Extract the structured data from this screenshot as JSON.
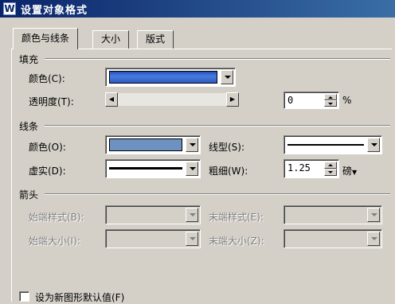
{
  "title": {
    "icon_letter": "W",
    "text": "设置对象格式"
  },
  "tabs": [
    {
      "label": "颜色与线条",
      "active": true
    },
    {
      "label": "大小",
      "active": false
    },
    {
      "label": "版式",
      "active": false
    }
  ],
  "fill": {
    "section": "填充",
    "color_label": "颜色(C):",
    "color_value": "#3a63c8",
    "transparency_label": "透明度(T):",
    "transparency_value": "0",
    "unit": "%"
  },
  "line": {
    "section": "线条",
    "color_label": "颜色(O):",
    "color_value": "#6d92c2",
    "style_label": "线型(S):",
    "dash_label": "虚实(D):",
    "weight_label": "粗细(W):",
    "weight_value": "1.25",
    "weight_unit": "磅"
  },
  "arrows": {
    "section": "箭头",
    "begin_style_label": "始端样式(B):",
    "end_style_label": "末端样式(E):",
    "begin_size_label": "始端大小(I):",
    "end_size_label": "末端大小(Z):"
  },
  "default_checkbox": {
    "label": "设为新图形默认值(F)",
    "checked": false
  }
}
